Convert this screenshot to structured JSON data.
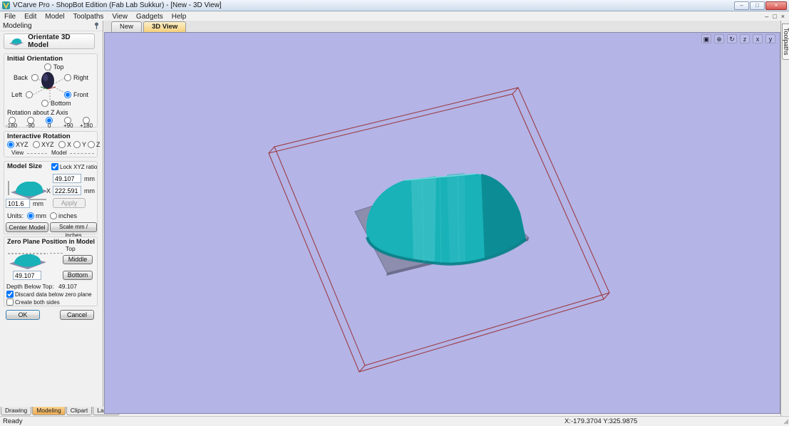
{
  "window": {
    "title": "VCarve Pro - ShopBot Edition (Fab Lab Sukkur) - [New - 3D View]",
    "menu_items": [
      "File",
      "Edit",
      "Model",
      "Toolpaths",
      "View",
      "Gadgets",
      "Help"
    ],
    "controls": {
      "minimize": "–",
      "maximize": "□",
      "close": "×"
    },
    "mdi_controls": {
      "minimize": "–",
      "restore": "□",
      "close": "×"
    }
  },
  "doc_tabs": {
    "tabs": [
      "New",
      "3D View"
    ],
    "active": "3D View"
  },
  "right_tab": {
    "label": "Toolpaths"
  },
  "bottom_tabs": {
    "tabs": [
      "Drawing",
      "Modeling",
      "Clipart",
      "Layers"
    ],
    "active": "Modeling"
  },
  "statusbar": {
    "ready": "Ready",
    "coords": "X:-179.3704 Y:325.9875"
  },
  "viewport": {
    "icons": [
      {
        "glyph": "▣"
      },
      {
        "glyph": "⊕"
      },
      {
        "glyph": "↻"
      },
      {
        "glyph": "z"
      },
      {
        "glyph": "x"
      },
      {
        "glyph": "y"
      }
    ]
  },
  "panel": {
    "title": "Modeling",
    "tool_title": "Orientate 3D Model",
    "orientation": {
      "title": "Initial Orientation",
      "options": [
        "Top",
        "Back",
        "Right",
        "Left",
        "Front",
        "Bottom"
      ],
      "selected": "Front",
      "z_label": "Rotation about Z Axis",
      "z_options": [
        "-180",
        "-90",
        "0",
        "+90",
        "+180"
      ],
      "z_selected": "0"
    },
    "interactive": {
      "title": "Interactive Rotation",
      "options": [
        "XYZ",
        "XYZ",
        "X",
        "Y",
        "Z"
      ],
      "selected_index": 0,
      "view_label": "View",
      "model_label": "Model"
    },
    "size": {
      "title": "Model Size",
      "lock": "Lock XYZ ratio",
      "lock_checked": true,
      "z_value": "49.107",
      "x_value": "222.591",
      "y_value": "101.6",
      "x_label": "X",
      "unit": "mm",
      "apply": "Apply",
      "units_label": "Units:",
      "unit_mm": "mm",
      "unit_inches": "inches",
      "units_selected": "mm",
      "center_button": "Center Model",
      "scale_button": "Scale mm / inches"
    },
    "zero_plane": {
      "title": "Zero Plane Position in Model",
      "top_label": "Top",
      "middle_button": "Middle",
      "bottom_button": "Bottom",
      "value": "49.107",
      "depth_label": "Depth Below Top:",
      "depth_value": "49.107",
      "discard": "Discard data below zero plane",
      "discard_checked": true,
      "both": "Create both sides",
      "both_checked": false
    },
    "ok": "OK",
    "cancel": "Cancel"
  },
  "colors": {
    "viewport_bg": "#b4b4e6",
    "model_teal": "#18b2b8",
    "model_teal_dark": "#0c8d95",
    "slab_gray": "#8d8dad",
    "wire_red": "#993338",
    "active_tab": "#f4cf7c"
  }
}
